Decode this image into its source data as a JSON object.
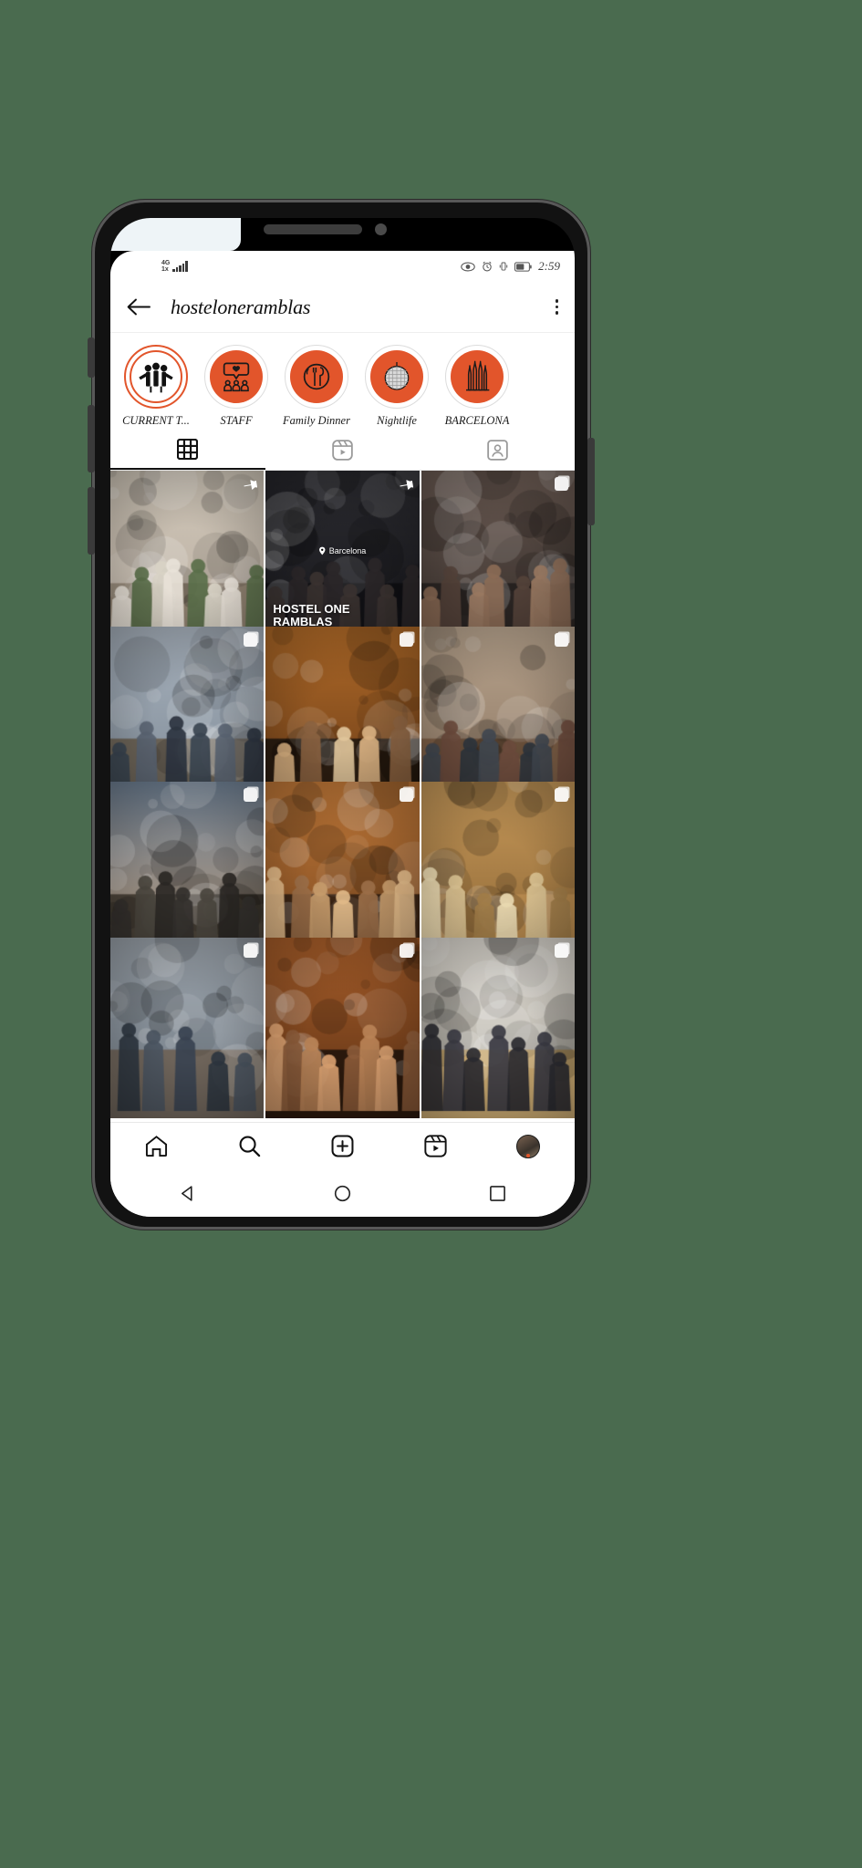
{
  "status_bar": {
    "network_type": "4G",
    "network_sub": "1x",
    "signal_icon": "signal-bars-icon",
    "eye_icon": "eye-icon",
    "alarm_icon": "alarm-clock-icon",
    "vibrate_icon": "vibrate-icon",
    "battery_icon": "battery-icon",
    "time": "2:59"
  },
  "header": {
    "back_icon": "back-arrow-icon",
    "username": "hosteloneramblas",
    "menu_icon": "kebab-menu-icon"
  },
  "highlights": [
    {
      "label": "CURRENT T...",
      "icon": "people-group-icon",
      "style": "white",
      "active": true
    },
    {
      "label": "STAFF",
      "icon": "speech-bubble-people-icon",
      "style": "orange",
      "active": false
    },
    {
      "label": "Family Dinner",
      "icon": "plate-cutlery-icon",
      "style": "orange",
      "active": false
    },
    {
      "label": "Nightlife",
      "icon": "disco-ball-icon",
      "style": "orange",
      "active": false
    },
    {
      "label": "BARCELONA",
      "icon": "sagrada-familia-icon",
      "style": "orange",
      "active": false
    }
  ],
  "tabs": [
    {
      "name": "grid",
      "icon": "grid-icon",
      "selected": true
    },
    {
      "name": "reels",
      "icon": "reels-icon",
      "selected": false
    },
    {
      "name": "tagged",
      "icon": "tagged-person-icon",
      "selected": false
    }
  ],
  "grid": [
    {
      "id": "post-1",
      "badge": "pin",
      "theme": "street-map-group",
      "caption": ""
    },
    {
      "id": "post-2",
      "badge": "pin",
      "theme": "hostel-sign-man",
      "caption": "HOSTEL ONE\nRAMBLAS",
      "location": "Barcelona"
    },
    {
      "id": "post-3",
      "badge": "multi",
      "theme": "bar-sunglasses",
      "caption": ""
    },
    {
      "id": "post-4",
      "badge": "multi",
      "theme": "graffiti-wall",
      "caption": ""
    },
    {
      "id": "post-5",
      "badge": "multi",
      "theme": "night-street",
      "caption": ""
    },
    {
      "id": "post-6",
      "badge": "multi",
      "theme": "lounge-couch",
      "caption": ""
    },
    {
      "id": "post-7",
      "badge": "multi",
      "theme": "sunset-hill",
      "caption": ""
    },
    {
      "id": "post-8",
      "badge": "multi",
      "theme": "warm-crowd",
      "caption": ""
    },
    {
      "id": "post-9",
      "badge": "multi",
      "theme": "table-cards",
      "caption": ""
    },
    {
      "id": "post-10",
      "badge": "multi",
      "theme": "mural-street",
      "caption": ""
    },
    {
      "id": "post-11",
      "badge": "multi",
      "theme": "orange-night",
      "caption": ""
    },
    {
      "id": "post-12",
      "badge": "multi",
      "theme": "bowling-alley",
      "caption": ""
    }
  ],
  "bottom_nav": [
    {
      "name": "home",
      "icon": "home-icon"
    },
    {
      "name": "search",
      "icon": "search-icon"
    },
    {
      "name": "create",
      "icon": "plus-square-icon"
    },
    {
      "name": "reels",
      "icon": "reels-icon"
    },
    {
      "name": "profile",
      "icon": "avatar-icon"
    }
  ],
  "android_nav": [
    {
      "name": "back",
      "icon": "triangle-back-icon"
    },
    {
      "name": "home",
      "icon": "circle-home-icon"
    },
    {
      "name": "recent",
      "icon": "square-recents-icon"
    }
  ],
  "colors": {
    "brand_orange": "#E2552B",
    "background_green": "#4a6b4f",
    "text_primary": "#111111"
  }
}
